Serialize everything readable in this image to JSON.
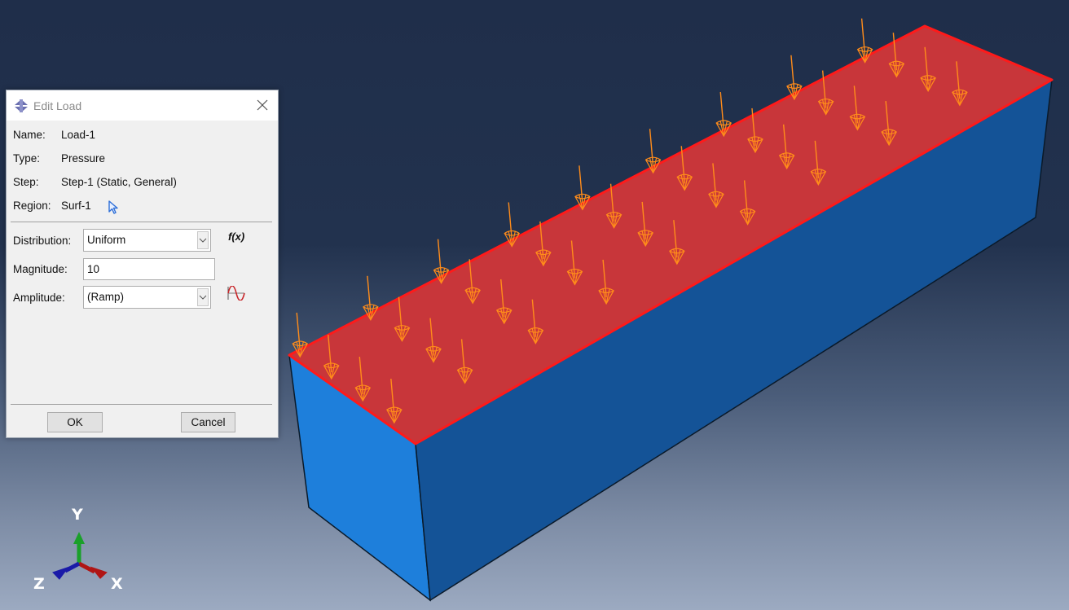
{
  "viewport": {
    "model": {
      "top_face_color": "#c8363a",
      "top_edge_color": "#ff1a1a",
      "front_face_color": "#1e7fdb",
      "side_face_color": "#145397",
      "load_arrow_color": "#ff8c1a",
      "load_arrow_rows": 4,
      "load_arrow_cols": 9
    },
    "triad": {
      "x_label": "X",
      "y_label": "Y",
      "z_label": "Z",
      "x_color": "#c0151a",
      "y_color": "#1aa02a",
      "z_color": "#1a1aa8"
    }
  },
  "dialog": {
    "title": "Edit Load",
    "info": [
      {
        "label": "Name:",
        "value": "Load-1"
      },
      {
        "label": "Type:",
        "value": "Pressure"
      },
      {
        "label": "Step:",
        "value": "Step-1 (Static, General)"
      },
      {
        "label": "Region:",
        "value": "Surf-1"
      }
    ],
    "distribution": {
      "label": "Distribution:",
      "value": "Uniform"
    },
    "fx_label": "f(x)",
    "magnitude": {
      "label": "Magnitude:",
      "value": "10"
    },
    "amplitude": {
      "label": "Amplitude:",
      "value": "(Ramp)"
    },
    "ok_label": "OK",
    "cancel_label": "Cancel"
  }
}
